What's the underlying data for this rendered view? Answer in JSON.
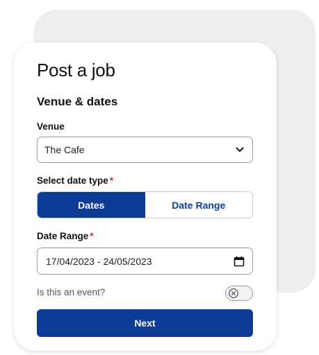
{
  "form": {
    "title": "Post a job",
    "section_title": "Venue & dates",
    "venue": {
      "label": "Venue",
      "value": "The Cafe",
      "icon": "chevron-down-icon"
    },
    "date_type": {
      "label": "Select date type",
      "required_mark": "*",
      "options": [
        "Dates",
        "Date Range"
      ],
      "selected": "Dates"
    },
    "date_range": {
      "label": "Date Range",
      "required_mark": "*",
      "value": "17/04/2023 - 24/05/2023",
      "icon": "calendar-icon"
    },
    "event": {
      "label": "Is this an event?",
      "toggle_on": false,
      "icon": "x-circle-icon"
    },
    "next_label": "Next"
  },
  "colors": {
    "primary": "#0c3b97",
    "required": "#e0242c",
    "back_card": "#eeeeef"
  }
}
